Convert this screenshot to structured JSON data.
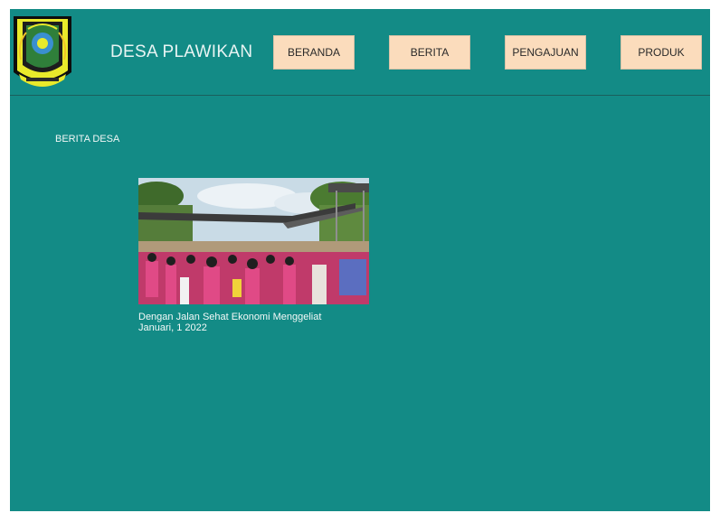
{
  "header": {
    "site_title": "DESA PLAWIKAN",
    "nav": [
      {
        "label": "BERANDA"
      },
      {
        "label": "BERITA"
      },
      {
        "label": "PENGAJUAN"
      },
      {
        "label": "PRODUK"
      }
    ]
  },
  "main": {
    "section_title": "BERITA DESA",
    "news": [
      {
        "title": "Dengan Jalan Sehat Ekonomi Menggeliat",
        "date": "Januari, 1 2022",
        "image_alt": "crowd-at-village-event"
      }
    ]
  },
  "colors": {
    "background": "#138b86",
    "nav_button": "#fbdcbc",
    "text_light": "#f4f9f8"
  }
}
